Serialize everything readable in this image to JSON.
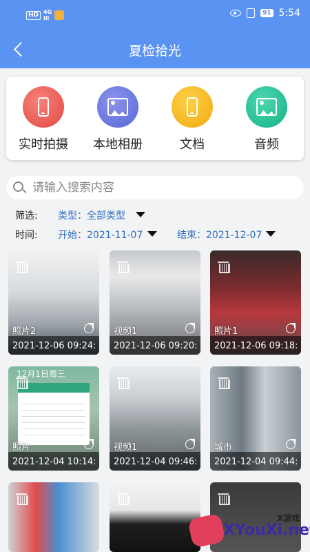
{
  "statusbar": {
    "hd": "HD",
    "signal": "4G",
    "signal_sub": "ill",
    "battery": "91",
    "time": "5:54"
  },
  "appbar": {
    "title": "夏检拾光"
  },
  "sources": [
    {
      "label": "实时拍摄",
      "icon": "phone-icon",
      "color": "#ee5a52"
    },
    {
      "label": "本地相册",
      "icon": "image-icon",
      "color": "#6a76de"
    },
    {
      "label": "文档",
      "icon": "phone-icon",
      "color": "#f5b616"
    },
    {
      "label": "音频",
      "icon": "image-icon",
      "color": "#1fbf94"
    }
  ],
  "search": {
    "placeholder": "请输入搜索内容"
  },
  "filters": {
    "filter_label": "筛选:",
    "type_value": "类型：全部类型",
    "time_label": "时间:",
    "start_value": "开始：2021-11-07",
    "end_value": "结束：2021-12-07"
  },
  "items": [
    {
      "name": "照片2",
      "time": "2021-12-06 09:24:"
    },
    {
      "name": "视频1",
      "time": "2021-12-06 09:20:"
    },
    {
      "name": "照片1",
      "time": "2021-12-06 09:18:"
    },
    {
      "name": "照片",
      "time": "2021-12-04 10:14:"
    },
    {
      "name": "视频1",
      "time": "2021-12-04 09:46:"
    },
    {
      "name": "城市",
      "time": "2021-12-04 09:44:"
    }
  ],
  "calendar": {
    "title": "12月1日周三"
  },
  "watermark": {
    "small": "X游戏",
    "big": "XYouXi.net"
  }
}
